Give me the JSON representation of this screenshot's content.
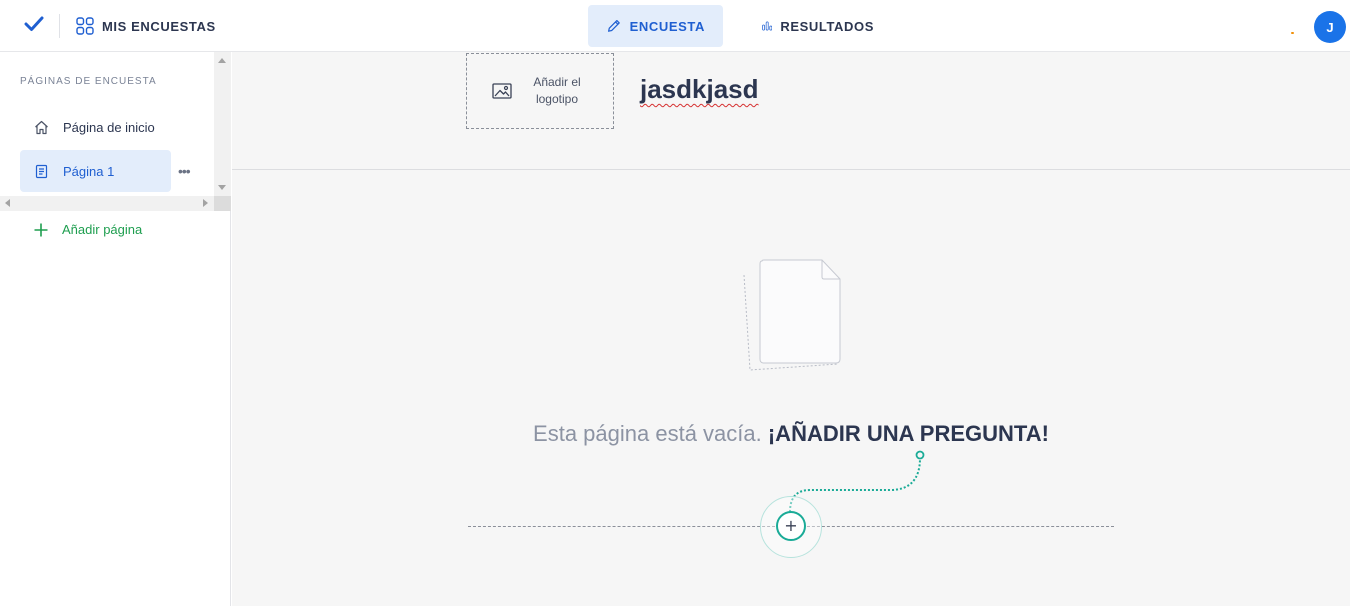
{
  "topbar": {
    "logo_icon": "checkmark-icon",
    "my_surveys_label": "MIS ENCUESTAS",
    "tabs": [
      {
        "label": "ENCUESTA",
        "icon": "pencil-icon",
        "active": true
      },
      {
        "label": "RESULTADOS",
        "icon": "bar-chart-icon",
        "active": false
      }
    ],
    "avatar_initial": "J"
  },
  "sidebar": {
    "title": "PÁGINAS DE ENCUESTA",
    "items": [
      {
        "label": "Página de inicio",
        "icon": "home-icon",
        "active": false
      },
      {
        "label": "Página 1",
        "icon": "page-icon",
        "active": true
      }
    ],
    "more_label": "•••",
    "add_page_label": "Añadir página"
  },
  "main": {
    "logo_placeholder": "Añadir el logotipo",
    "survey_title": "jasdkjasd",
    "empty_text": "Esta página está vacía.",
    "add_question_cta": "¡AÑADIR UNA PREGUNTA!",
    "add_question_symbol": "+"
  },
  "colors": {
    "accent_blue": "#1f5fd1",
    "active_bg": "#e3edfb",
    "green": "#1e9e4f",
    "teal": "#1aab97",
    "avatar": "#1a73e8"
  }
}
